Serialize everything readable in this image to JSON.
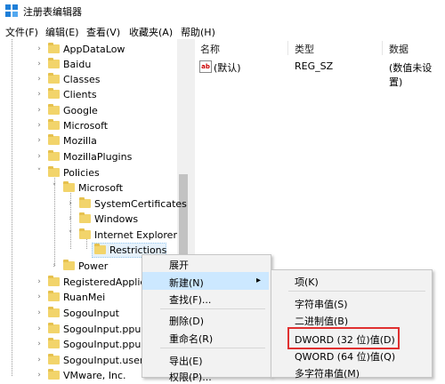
{
  "window": {
    "title": "注册表编辑器"
  },
  "menu": [
    "文件(F)",
    "编辑(E)",
    "查看(V)",
    "收藏夹(A)",
    "帮助(H)"
  ],
  "tree": {
    "items": [
      {
        "label": "AppDataLow"
      },
      {
        "label": "Baidu"
      },
      {
        "label": "Classes"
      },
      {
        "label": "Clients"
      },
      {
        "label": "Google"
      },
      {
        "label": "Microsoft"
      },
      {
        "label": "Mozilla"
      },
      {
        "label": "MozillaPlugins"
      },
      {
        "label": "Policies"
      },
      {
        "label": "Microsoft"
      },
      {
        "label": "SystemCertificates"
      },
      {
        "label": "Windows"
      },
      {
        "label": "Internet Explorer"
      },
      {
        "label": "Restrictions"
      },
      {
        "label": "Power"
      },
      {
        "label": "RegisteredApplic"
      },
      {
        "label": "RuanMei"
      },
      {
        "label": "SogouInput"
      },
      {
        "label": "SogouInput.ppup"
      },
      {
        "label": "SogouInput.ppup"
      },
      {
        "label": "SogouInput.user"
      },
      {
        "label": "VMware, Inc."
      }
    ]
  },
  "list": {
    "columns": [
      "名称",
      "类型",
      "数据"
    ],
    "rows": [
      {
        "name": "(默认)",
        "type": "REG_SZ",
        "data": "(数值未设置)"
      }
    ]
  },
  "context_menu": {
    "items": [
      "展开",
      "新建(N)",
      "查找(F)...",
      "删除(D)",
      "重命名(R)",
      "导出(E)",
      "权限(P)..."
    ]
  },
  "submenu": {
    "items": [
      "项(K)",
      "字符串值(S)",
      "二进制值(B)",
      "DWORD (32 位)值(D)",
      "QWORD (64 位)值(Q)",
      "多字符串值(M)"
    ]
  },
  "colors": {
    "highlight": "#cce8ff",
    "annotation": "#e03030",
    "folder": "#f2d46b"
  }
}
